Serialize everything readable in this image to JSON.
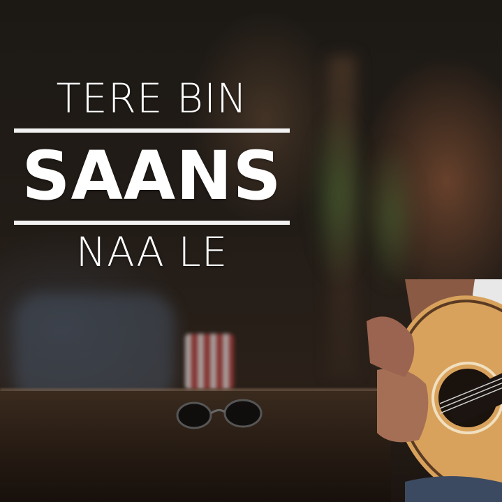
{
  "title": {
    "line1": "TERE BIN",
    "line2": "SAANS",
    "line3": "NAA LE"
  },
  "colors": {
    "text": "#ffffff",
    "rule": "#f2f2f2",
    "guitar_body": "#d9a25c",
    "shirt": "#e8e8e8"
  }
}
